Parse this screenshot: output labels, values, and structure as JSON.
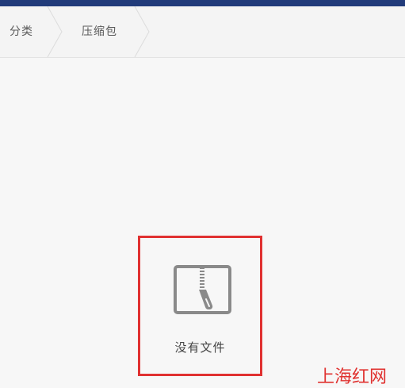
{
  "breadcrumb": {
    "items": [
      {
        "label": "分类"
      },
      {
        "label": "压缩包"
      }
    ]
  },
  "empty_state": {
    "message": "没有文件",
    "icon": "zip-file-icon"
  },
  "watermark": {
    "text": "上海红网"
  },
  "colors": {
    "top_strip": "#213b7a",
    "highlight_border": "#e03131",
    "watermark": "#e0312f",
    "icon": "#8a8a8a"
  }
}
